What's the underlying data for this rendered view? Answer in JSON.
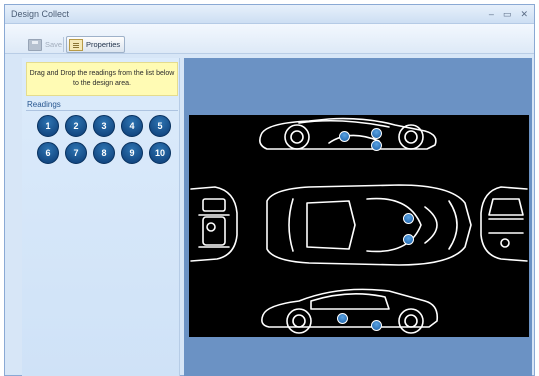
{
  "window": {
    "title": "Design Collect",
    "controls": {
      "minimize": "–",
      "maximize": "▭",
      "close": "✕"
    }
  },
  "toolbar": {
    "save_label": "Save",
    "properties_label": "Properties"
  },
  "left_panel": {
    "hint": "Drag and Drop the readings from the list below to the design area.",
    "readings_label": "Readings",
    "readings": [
      "1",
      "2",
      "3",
      "4",
      "5",
      "6",
      "7",
      "8",
      "9",
      "10"
    ]
  },
  "design_area": {
    "image": "car-blueprint-diagram",
    "placed_pins": 7
  },
  "colors": {
    "reading_button": "#0b3a73",
    "design_background": "#6b92c4",
    "hint_background": "#fffbb4"
  }
}
